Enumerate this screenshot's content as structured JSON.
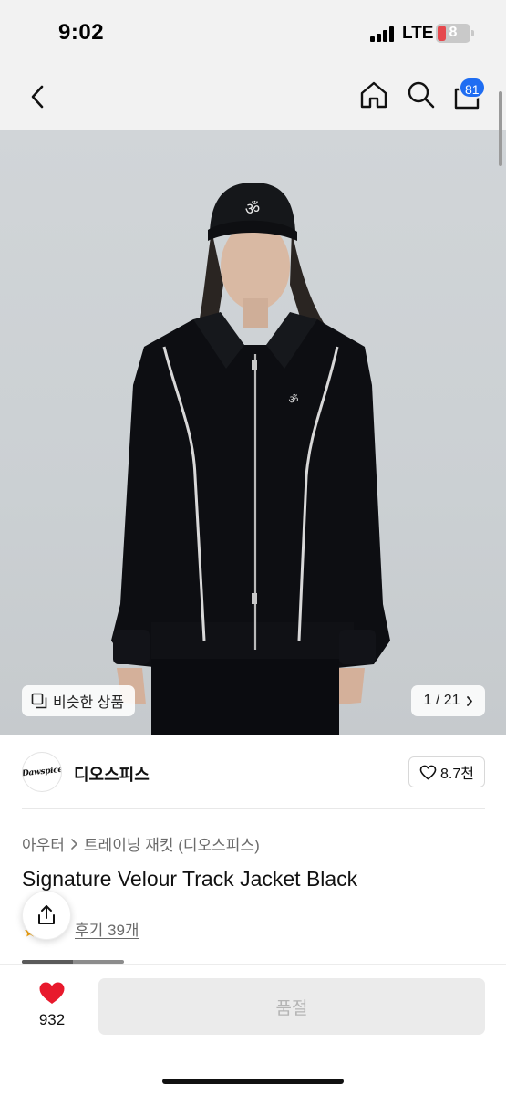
{
  "status_bar": {
    "time": "9:02",
    "network": "LTE",
    "battery": "8",
    "colors": {
      "battery_low": "#e5484d"
    }
  },
  "nav": {
    "back_icon": "chevron-left-icon",
    "home_icon": "home-icon",
    "search_icon": "search-icon",
    "bag_icon": "shopping-bag-icon",
    "cart_count": "81",
    "badge_color": "#1f6df2"
  },
  "gallery": {
    "similar_label": "비슷한 상품",
    "pager": "1 / 21",
    "pager_icon": "chevron-right-icon"
  },
  "brand": {
    "logo_text": "Dawspice",
    "name": "디오스피스",
    "likes": "8.7천"
  },
  "product": {
    "breadcrumb": [
      "아우터",
      "트레이닝 재킷 (디오스피스)"
    ],
    "title": "Signature Velour Track Jacket Black",
    "review_text": "후기 39개"
  },
  "bottom": {
    "wish_count": "932",
    "heart_color": "#e8192c",
    "soldout_label": "품절"
  }
}
